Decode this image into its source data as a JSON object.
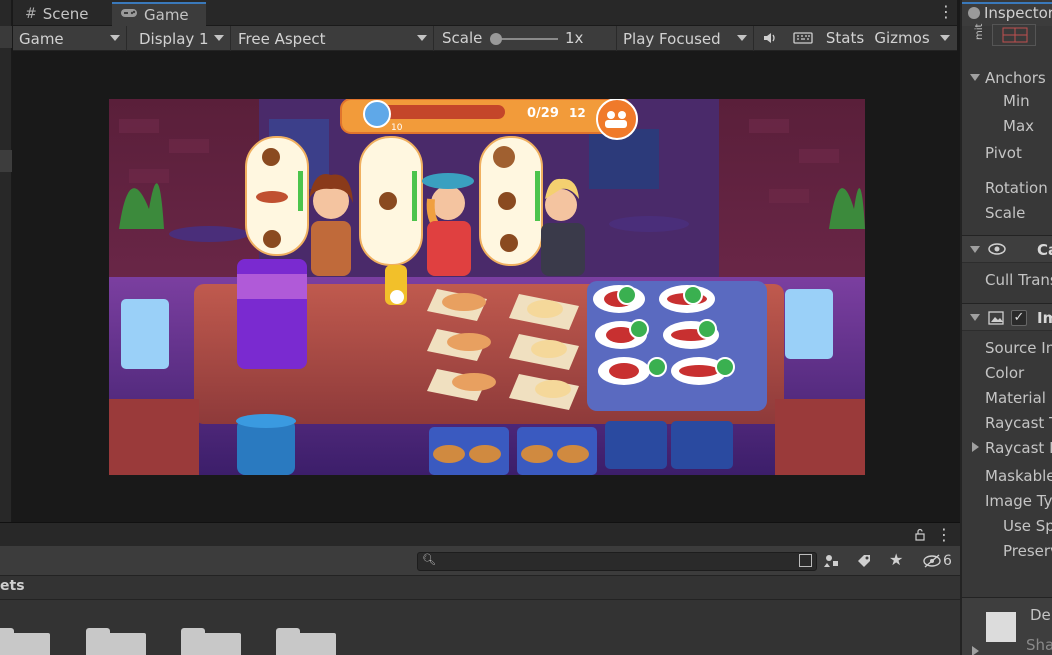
{
  "tabs": [
    {
      "label": "Scene",
      "icon": "grid-icon"
    },
    {
      "label": "Game",
      "icon": "gamepad-icon"
    }
  ],
  "toolbar": {
    "display_mode": "Game",
    "display": "Display 1",
    "aspect": "Free Aspect",
    "scale_label": "Scale",
    "scale_value": "1x",
    "scale_level": 0.0,
    "play_mode": "Play Focused",
    "stats_label": "Stats",
    "gizmos_label": "Gizmos"
  },
  "game": {
    "progress_text": "0/29",
    "level_badge": "10",
    "coins": "12",
    "progress_fraction": 0.0
  },
  "project": {
    "assets_label": "ets",
    "visibility_count": "6",
    "search_placeholder": ""
  },
  "inspector": {
    "tab_label": "Inspector",
    "rect_label": "mit",
    "anchors": "Anchors",
    "min": "Min",
    "max": "Max",
    "pivot": "Pivot",
    "rotation": "Rotation",
    "scale": "Scale",
    "canvas_renderer_hdr": "Ca",
    "cull_transparent": "Cull Trans",
    "image_hdr": "Im",
    "source_image": "Source Im",
    "color": "Color",
    "material": "Material",
    "raycast_target": "Raycast T",
    "raycast_padding": "Raycast P",
    "maskable": "Maskable",
    "image_type": "Image Ty",
    "use_sprite": "Use Sp",
    "preserve": "Preserv",
    "default_label": "De",
    "shader_label": "Sha"
  },
  "colors": {
    "accent_blue": "#3a79bb",
    "panel": "#3c3c3c",
    "background": "#191919"
  }
}
